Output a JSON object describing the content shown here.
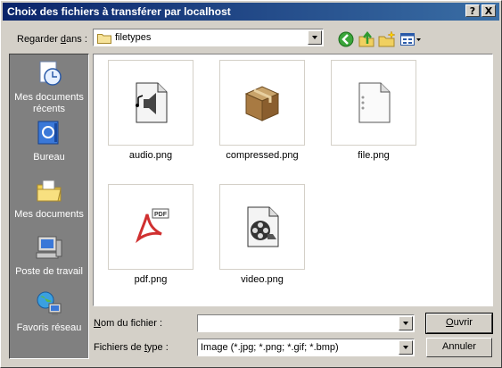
{
  "window": {
    "title": "Choix des fichiers à transférer par localhost"
  },
  "titlebar_buttons": {
    "help": "?",
    "close": "X"
  },
  "look_in": {
    "label_prefix": "Regarder ",
    "label_underlined": "d",
    "label_suffix": "ans :",
    "value": "filetypes"
  },
  "toolbar": {
    "back_icon": "back-icon",
    "up_icon": "up-folder-icon",
    "new_folder_icon": "new-folder-icon",
    "view_icon": "view-menu-icon"
  },
  "places": [
    {
      "id": "recent",
      "label": "Mes documents récents",
      "icon": "recent-documents-icon"
    },
    {
      "id": "desktop",
      "label": "Bureau",
      "icon": "desktop-icon"
    },
    {
      "id": "documents",
      "label": "Mes documents",
      "icon": "my-documents-icon"
    },
    {
      "id": "computer",
      "label": "Poste de travail",
      "icon": "computer-icon"
    },
    {
      "id": "network",
      "label": "Favoris réseau",
      "icon": "network-icon"
    }
  ],
  "files": [
    {
      "name": "audio.png",
      "icon": "audio-file-icon"
    },
    {
      "name": "compressed.png",
      "icon": "compressed-file-icon"
    },
    {
      "name": "file.png",
      "icon": "generic-file-icon"
    },
    {
      "name": "pdf.png",
      "icon": "pdf-file-icon"
    },
    {
      "name": "video.png",
      "icon": "video-file-icon"
    }
  ],
  "filename": {
    "label_underlined": "N",
    "label_rest": "om du fichier :",
    "value": ""
  },
  "filetype": {
    "label_prefix": "Fichiers de ",
    "label_underlined": "t",
    "label_suffix": "ype :",
    "value": "Image (*.jpg; *.png; *.gif; *.bmp)"
  },
  "buttons": {
    "open_underlined": "O",
    "open_rest": "uvrir",
    "cancel": "Annuler"
  }
}
